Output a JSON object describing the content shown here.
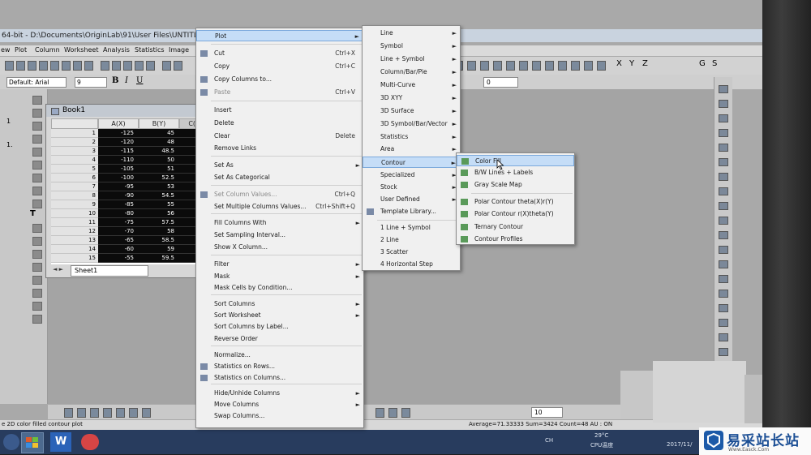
{
  "title_bar": {
    "text": "64-bit - D:\\Documents\\OriginLab\\91\\User Files\\UNTITLED"
  },
  "menubar": {
    "items": [
      "ew",
      "Plot",
      "Column",
      "Worksheet",
      "Analysis",
      "Statistics",
      "Image"
    ]
  },
  "format_toolbar": {
    "font": "Default: Arial",
    "size": "9",
    "combo_value": "0",
    "right_labels": [
      "X",
      "Y",
      "Z",
      "G",
      "S"
    ]
  },
  "left_numbers": [
    "1",
    "1."
  ],
  "book": {
    "title": "Book1",
    "columns": [
      "A(X)",
      "B(Y)",
      "C(Z)"
    ],
    "rows": [
      {
        "n": "1",
        "a": "-125",
        "b": "45"
      },
      {
        "n": "2",
        "a": "-120",
        "b": "48"
      },
      {
        "n": "3",
        "a": "-115",
        "b": "48.5"
      },
      {
        "n": "4",
        "a": "-110",
        "b": "50"
      },
      {
        "n": "5",
        "a": "-105",
        "b": "51"
      },
      {
        "n": "6",
        "a": "-100",
        "b": "52.5"
      },
      {
        "n": "7",
        "a": "-95",
        "b": "53"
      },
      {
        "n": "8",
        "a": "-90",
        "b": "54.5"
      },
      {
        "n": "9",
        "a": "-85",
        "b": "55"
      },
      {
        "n": "10",
        "a": "-80",
        "b": "56"
      },
      {
        "n": "11",
        "a": "-75",
        "b": "57.5"
      },
      {
        "n": "12",
        "a": "-70",
        "b": "58"
      },
      {
        "n": "13",
        "a": "-65",
        "b": "58.5"
      },
      {
        "n": "14",
        "a": "-60",
        "b": "59"
      },
      {
        "n": "15",
        "a": "-55",
        "b": "59.5"
      }
    ],
    "sheet_tab": "Sheet1"
  },
  "context_menu": {
    "items": [
      {
        "label": "Plot",
        "shortcut": "",
        "arrow": "►",
        "disabled": false,
        "highlight": true
      },
      {
        "label": "Cut",
        "shortcut": "Ctrl+X",
        "arrow": "",
        "disabled": false
      },
      {
        "label": "Copy",
        "shortcut": "Ctrl+C",
        "arrow": "",
        "disabled": false
      },
      {
        "label": "Copy Columns to...",
        "shortcut": "",
        "arrow": "",
        "disabled": false
      },
      {
        "label": "Paste",
        "shortcut": "Ctrl+V",
        "arrow": "",
        "disabled": true
      },
      {
        "label": "Insert",
        "shortcut": "",
        "arrow": "",
        "disabled": false
      },
      {
        "label": "Delete",
        "shortcut": "",
        "arrow": "",
        "disabled": false
      },
      {
        "label": "Clear",
        "shortcut": "Delete",
        "arrow": "",
        "disabled": false
      },
      {
        "label": "Remove Links",
        "shortcut": "",
        "arrow": "",
        "disabled": false
      },
      {
        "label": "Set As",
        "shortcut": "",
        "arrow": "►",
        "disabled": false
      },
      {
        "label": "Set As Categorical",
        "shortcut": "",
        "arrow": "",
        "disabled": false
      },
      {
        "label": "Set Column Values...",
        "shortcut": "Ctrl+Q",
        "arrow": "",
        "disabled": true
      },
      {
        "label": "Set Multiple Columns Values...",
        "shortcut": "Ctrl+Shift+Q",
        "arrow": "",
        "disabled": false
      },
      {
        "label": "Fill Columns With",
        "shortcut": "",
        "arrow": "►",
        "disabled": false
      },
      {
        "label": "Set Sampling Interval...",
        "shortcut": "",
        "arrow": "",
        "disabled": false
      },
      {
        "label": "Show X Column...",
        "shortcut": "",
        "arrow": "",
        "disabled": false
      },
      {
        "label": "Filter",
        "shortcut": "",
        "arrow": "►",
        "disabled": false
      },
      {
        "label": "Mask",
        "shortcut": "",
        "arrow": "►",
        "disabled": false
      },
      {
        "label": "Mask Cells by Condition...",
        "shortcut": "",
        "arrow": "",
        "disabled": false
      },
      {
        "label": "Sort Columns",
        "shortcut": "",
        "arrow": "►",
        "disabled": false
      },
      {
        "label": "Sort Worksheet",
        "shortcut": "",
        "arrow": "►",
        "disabled": false
      },
      {
        "label": "Sort Columns by Label...",
        "shortcut": "",
        "arrow": "",
        "disabled": false
      },
      {
        "label": "Reverse Order",
        "shortcut": "",
        "arrow": "",
        "disabled": false
      },
      {
        "label": "Normalize...",
        "shortcut": "",
        "arrow": "",
        "disabled": false
      },
      {
        "label": "Statistics on Rows...",
        "shortcut": "",
        "arrow": "",
        "disabled": false
      },
      {
        "label": "Statistics on Columns...",
        "shortcut": "",
        "arrow": "",
        "disabled": false
      },
      {
        "label": "Hide/Unhide Columns",
        "shortcut": "",
        "arrow": "►",
        "disabled": false
      },
      {
        "label": "Move Columns",
        "shortcut": "",
        "arrow": "►",
        "disabled": false
      },
      {
        "label": "Swap Columns...",
        "shortcut": "",
        "arrow": "",
        "disabled": false
      }
    ]
  },
  "plot_submenu": {
    "items": [
      {
        "label": "Line",
        "arrow": "►"
      },
      {
        "label": "Symbol",
        "arrow": "►"
      },
      {
        "label": "Line + Symbol",
        "arrow": "►"
      },
      {
        "label": "Column/Bar/Pie",
        "arrow": "►"
      },
      {
        "label": "Multi-Curve",
        "arrow": "►"
      },
      {
        "label": "3D XYY",
        "arrow": "►"
      },
      {
        "label": "3D Surface",
        "arrow": "►"
      },
      {
        "label": "3D Symbol/Bar/Vector",
        "arrow": "►"
      },
      {
        "label": "Statistics",
        "arrow": "►"
      },
      {
        "label": "Area",
        "arrow": "►"
      },
      {
        "label": "Contour",
        "arrow": "►",
        "highlight": true
      },
      {
        "label": "Specialized",
        "arrow": "►"
      },
      {
        "label": "Stock",
        "arrow": "►"
      },
      {
        "label": "User Defined",
        "arrow": "►"
      },
      {
        "label": "Template Library...",
        "arrow": ""
      },
      {
        "label": "1 Line + Symbol",
        "arrow": ""
      },
      {
        "label": "2 Line",
        "arrow": ""
      },
      {
        "label": "3 Scatter",
        "arrow": ""
      },
      {
        "label": "4 Horizontal Step",
        "arrow": ""
      }
    ]
  },
  "contour_submenu": {
    "items": [
      {
        "label": "Color Fill",
        "highlight": true
      },
      {
        "label": "B/W Lines + Labels"
      },
      {
        "label": "Gray Scale Map"
      },
      {
        "label": "Polar Contour theta(X)r(Y)"
      },
      {
        "label": "Polar Contour r(X)theta(Y)"
      },
      {
        "label": "Ternary Contour"
      },
      {
        "label": "Contour Profiles"
      }
    ]
  },
  "status_bar": {
    "left": "e 2D color filled contour plot",
    "right": "Average=71.33333 Sum=3424 Count=48  AU : ON"
  },
  "bottom_toolbar": {
    "combo_value": "10"
  },
  "taskbar": {
    "temp": "29°C",
    "cpu": "CPU温度",
    "date": "2017/11/",
    "ch": "CH"
  },
  "watermark": {
    "text": "易采站长站",
    "sub": "Www.Easck.Com"
  },
  "colors": {
    "highlight": "#c5ddf7",
    "menu_bg": "#f0f0f0",
    "grid_black": "#0b0b0b",
    "taskbar": "#283c5e"
  }
}
